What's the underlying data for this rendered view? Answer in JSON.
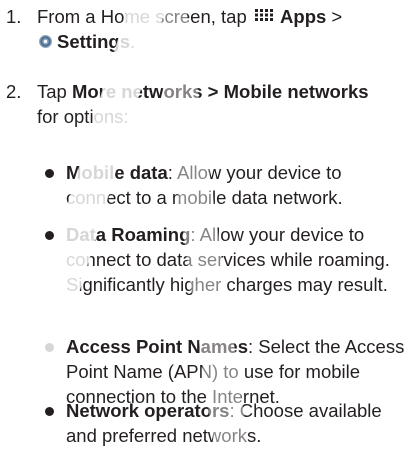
{
  "steps": [
    {
      "number": "1.",
      "pre": "From a Home screen, tap",
      "apps_label": "Apps",
      "separator": ">",
      "settings_label": "Settings",
      "suffix": "."
    },
    {
      "number": "2.",
      "pre": "Tap",
      "more_networks": "More networks",
      "separator": ">",
      "mobile_networks": "Mobile networks",
      "post": "for options:"
    }
  ],
  "options": [
    {
      "term": "Mobile data",
      "desc": ": Allow your device to connect to a mobile data network."
    },
    {
      "term": "Data Roaming",
      "desc": ": Allow your device to connect to data services while roaming. Significantly higher charges may result."
    },
    {
      "term": "Access Point Names",
      "desc": ": Select the Access Point Name (APN) to use for mobile connection to the Internet."
    },
    {
      "term": "Network operators",
      "desc": ": Choose available and preferred networks."
    }
  ],
  "colors": {
    "text": "#231f20",
    "watermark": "#ffffff"
  },
  "icons": {
    "apps": "apps-grid-icon",
    "settings": "settings-gear-icon"
  }
}
